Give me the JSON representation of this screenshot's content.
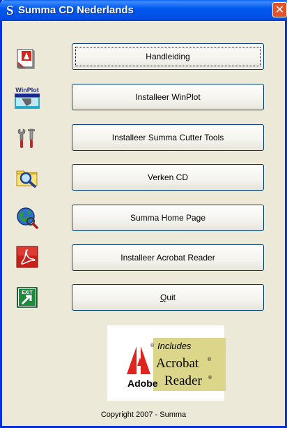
{
  "window": {
    "title": "Summa CD Nederlands",
    "logo_glyph": "S",
    "close_glyph": "✕"
  },
  "buttons": [
    {
      "name": "handleiding-button",
      "label": "Handleiding",
      "icon": "adobe-pdf-document-icon",
      "focused": true
    },
    {
      "name": "installeer-winplot-button",
      "label": "Installeer WinPlot",
      "icon": "winplot-icon",
      "icon_text": "WinPlot"
    },
    {
      "name": "installeer-cutter-tools-button",
      "label": "Installeer Summa Cutter Tools",
      "icon": "tools-icon"
    },
    {
      "name": "verken-cd-button",
      "label": "Verken CD",
      "icon": "folder-search-icon"
    },
    {
      "name": "home-page-button",
      "label": "Summa Home Page",
      "icon": "globe-search-icon"
    },
    {
      "name": "installeer-acrobat-button",
      "label": "Installeer Acrobat Reader",
      "icon": "acrobat-icon"
    },
    {
      "name": "quit-button",
      "label": "Quit",
      "label_mnemonic": "Q",
      "label_rest": "uit",
      "icon": "exit-icon",
      "icon_text": "EXIT"
    }
  ],
  "adobe_badge": {
    "includes": "Includes",
    "acrobat": "Acrobat",
    "reader": "Reader",
    "registered": "®",
    "adobe": "Adobe"
  },
  "copyright": "Copyright 2007 - Summa",
  "colors": {
    "titlebar": "#0054e3",
    "face": "#ece9d8",
    "adobe_red": "#e0231c",
    "badge_yellow": "#dcd68a"
  }
}
